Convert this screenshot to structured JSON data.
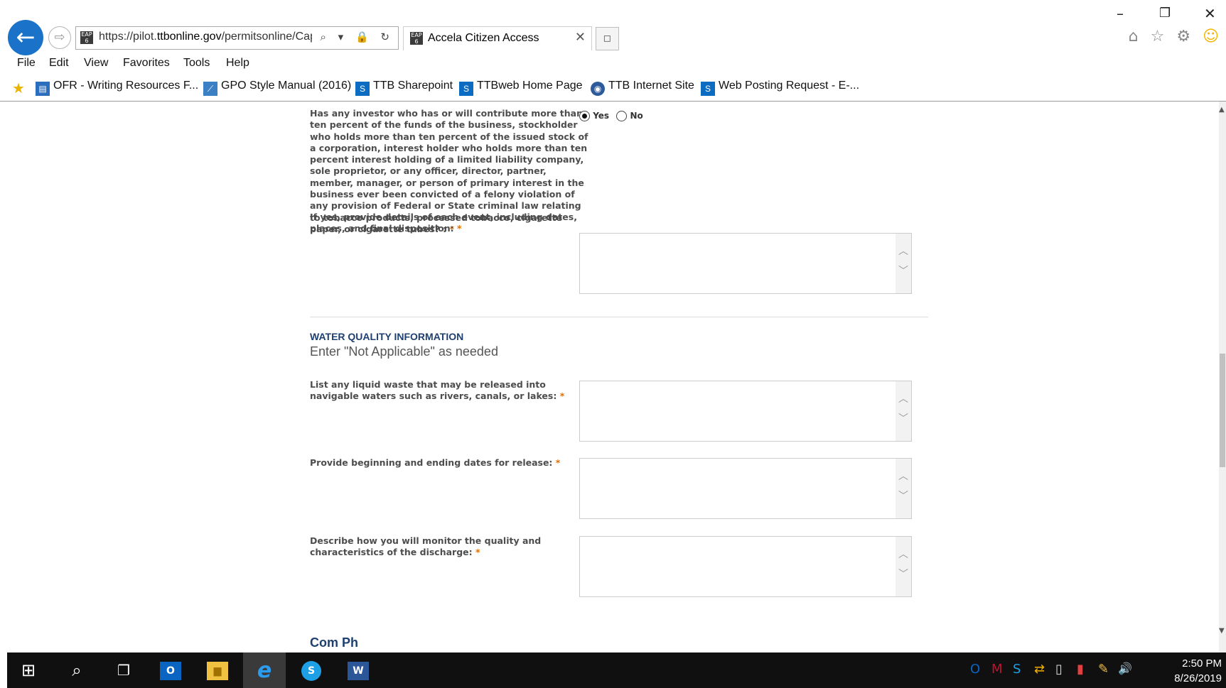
{
  "window": {
    "minimize": "–",
    "restore": "❐",
    "close": "✕"
  },
  "nav": {
    "back_glyph": "←",
    "forward_glyph": "⇨"
  },
  "address": {
    "favicon": "EAP 6",
    "url_prefix": "https://pilot.",
    "url_domain": "ttbonline.gov",
    "url_suffix": "/permitsonline/Cap",
    "icons": "⌕ ▾ 🔒 ↻"
  },
  "tab": {
    "favicon": "EAP 6",
    "title": "Accela Citizen Access",
    "close": "✕"
  },
  "toolbar_icons": {
    "home": "⌂",
    "favorites": "☆",
    "settings": "⚙",
    "feedback": "☺"
  },
  "menu": [
    "File",
    "Edit",
    "View",
    "Favorites",
    "Tools",
    "Help"
  ],
  "favorites_bar": [
    {
      "label": "OFR - Writing Resources F...",
      "icon": "▤",
      "color": "#2a6ebd"
    },
    {
      "label": "GPO Style Manual (2016)",
      "icon": "⟋",
      "color": "#3b7fc4"
    },
    {
      "label": "TTB Sharepoint",
      "icon": "S",
      "color": "#0b6cc2"
    },
    {
      "label": "TTBweb Home Page",
      "icon": "S",
      "color": "#0b6cc2"
    },
    {
      "label": "TTB Internet Site",
      "icon": "◉",
      "color": "#2c5a9a"
    },
    {
      "label": "Web Posting Request - E-...",
      "icon": "S",
      "color": "#0b6cc2"
    }
  ],
  "form": {
    "felony_question": "Has any investor who has or will contribute more than ten percent of the funds of the business, stockholder who holds more than ten percent of the issued stock of a corporation, interest holder who holds more than ten percent interest holding of a limited liability company, sole proprietor, or any officer, director, partner, member, manager, or person of primary interest in the business ever been convicted of a felony violation of any provision of Federal or State criminal law relating to tobacco products, processed tobacco, cigarette paper, or cigarette tubes? :",
    "required_mark": "*",
    "radio_yes": "Yes",
    "radio_no": "No",
    "selected": "Yes",
    "details_label": "If yes, provide details of each event, including dates, places, and final disposition:",
    "section_title": "WATER QUALITY INFORMATION",
    "section_subtitle": "Enter \"Not Applicable\" as needed",
    "liquid_waste_label": "List any liquid waste that may be released into navigable waters such as rivers, canals, or lakes:",
    "release_dates_label": "Provide beginning and ending dates for release:",
    "monitor_label": "Describe how you will monitor the quality and characteristics of the discharge:",
    "cut_heading": "Com Ph"
  },
  "taskbar": {
    "start": "⊞",
    "search": "⌕",
    "task_view": "❐",
    "apps": [
      {
        "name": "outlook",
        "glyph": "O",
        "color": "#0a64c2"
      },
      {
        "name": "explorer",
        "glyph": "▆",
        "color": "#f0c040"
      },
      {
        "name": "ie",
        "glyph": "e",
        "color": "#2b9cf0"
      },
      {
        "name": "skype",
        "glyph": "S",
        "color": "#1ea0e6"
      },
      {
        "name": "word",
        "glyph": "W",
        "color": "#2b5799"
      }
    ],
    "tray": [
      {
        "name": "outlook-tray",
        "glyph": "O",
        "color": "#0a64c2"
      },
      {
        "name": "mcafee",
        "glyph": "M",
        "color": "#c8102e"
      },
      {
        "name": "skype-tray",
        "glyph": "S",
        "color": "#1ea0e6"
      },
      {
        "name": "sync",
        "glyph": "⇄",
        "color": "#f0b000"
      },
      {
        "name": "usb",
        "glyph": "▯",
        "color": "#dddddd"
      },
      {
        "name": "battery",
        "glyph": "▮",
        "color": "#e04040"
      },
      {
        "name": "notes",
        "glyph": "✎",
        "color": "#f0c040"
      },
      {
        "name": "volume",
        "glyph": "🔊",
        "color": "#ffffff"
      }
    ],
    "time": "2:50 PM",
    "date": "8/26/2019"
  }
}
